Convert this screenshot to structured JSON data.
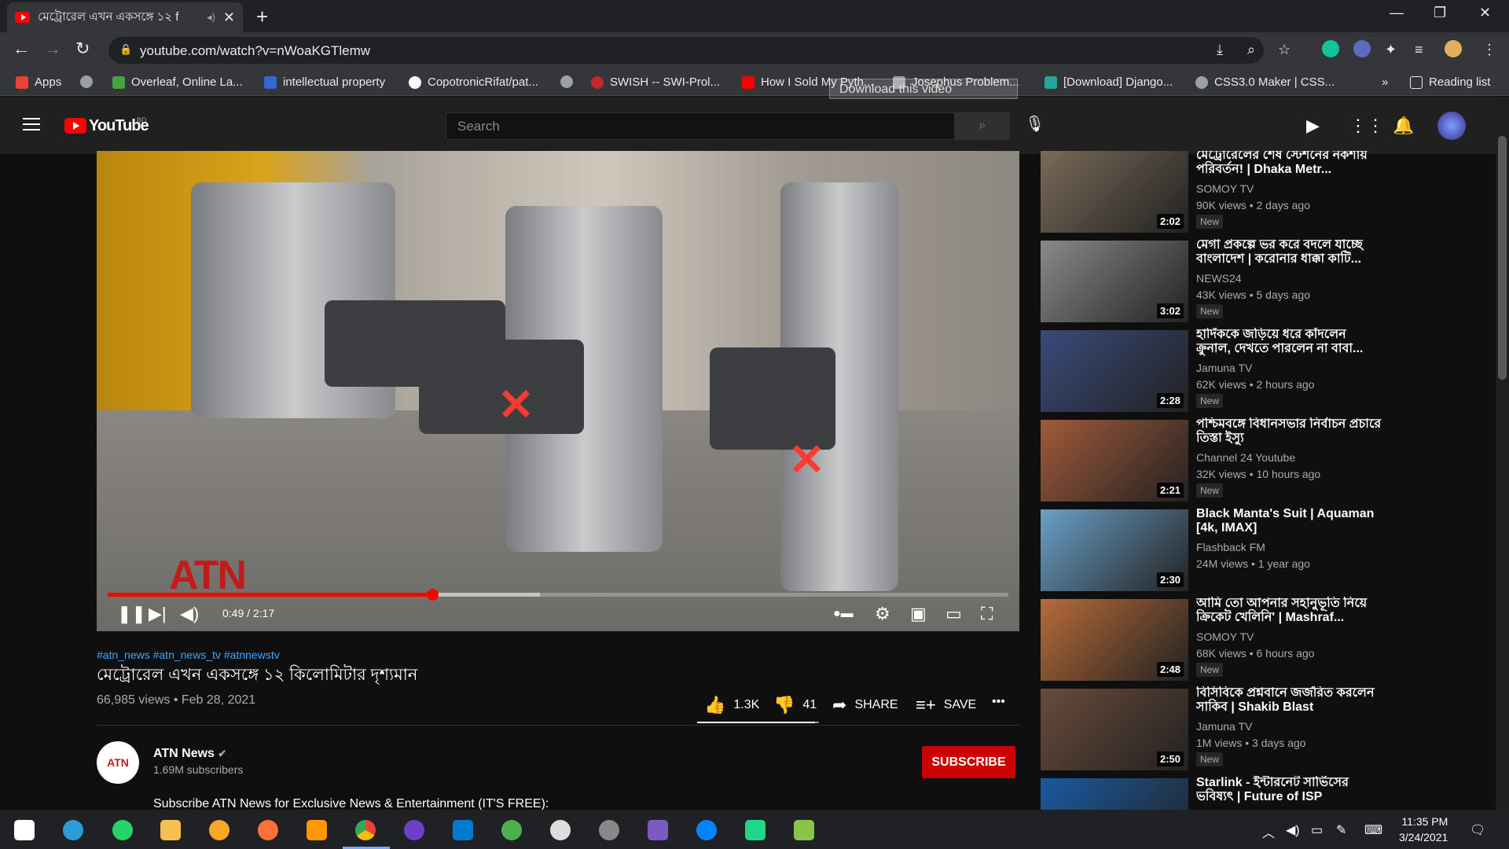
{
  "browser": {
    "tab_title": "মেট্রোরেল এখন একসঙ্গে ১২ f",
    "url": "youtube.com/watch?v=nWoaKGTlemw",
    "new_tab_label": "+",
    "close_label": "✕",
    "win_min": "—",
    "win_max": "❐",
    "win_close": "✕",
    "reading_list": "Reading list",
    "more_bookmarks": "»"
  },
  "bookmarks": [
    {
      "label": "Apps",
      "color": "#ea4335"
    },
    {
      "label": "",
      "color": "#9aa0a6"
    },
    {
      "label": "Overleaf, Online La...",
      "color": "#47a141"
    },
    {
      "label": "intellectual property",
      "color": "#3367d6"
    },
    {
      "label": "CopotronicRifat/pat...",
      "color": "#ffffff"
    },
    {
      "label": "",
      "color": "#9aa0a6"
    },
    {
      "label": "SWISH -- SWI-Prol...",
      "color": "#c62828"
    },
    {
      "label": "How I Sold My Pyth...",
      "color": "#ff0000"
    },
    {
      "label": "Josephus Problem...",
      "color": "#9aa0a6"
    },
    {
      "label": "[Download] Django...",
      "color": "#26a69a"
    },
    {
      "label": "CSS3.0 Maker | CSS...",
      "color": "#9aa0a6"
    }
  ],
  "youtube": {
    "logo_text": "YouTube",
    "country": "BD",
    "search_placeholder": "Search"
  },
  "player": {
    "download_label": "Download this video",
    "watermark": "ATN",
    "time": "0:49 / 2:17",
    "progress_played": 0.36,
    "progress_buffered": 0.48
  },
  "video": {
    "tags": "#atn_news #atn_news_tv #atnnewstv",
    "title": "মেট্রোরেল এখন একসঙ্গে ১২ কিলোমিটার দৃশ্যমান",
    "views": "66,985 views • Feb 28, 2021",
    "likes": "1.3K",
    "dislikes": "41",
    "like_ratio": 0.97,
    "share": "SHARE",
    "save": "SAVE",
    "more": "•••"
  },
  "channel": {
    "name": "ATN News",
    "subs": "1.69M subscribers",
    "avatar_text": "ATN",
    "subscribe": "SUBSCRIBE",
    "description": "Subscribe ATN News for Exclusive News & Entertainment (IT'S FREE):"
  },
  "recommendations": [
    {
      "title": "মেট্রোরেলের শেষ স্টেশনের নকশায় পরিবর্তন! | Dhaka Metr...",
      "channel": "SOMOY TV",
      "meta": "90K views • 2 days ago",
      "duration": "2:02",
      "new": "New",
      "color": "#7a6a58"
    },
    {
      "title": "মেগা প্রকল্পে ভর করে বদলে যাচ্ছে বাংলাদেশ | করোনার ধাক্কা কাটি...",
      "channel": "NEWS24",
      "meta": "43K views • 5 days ago",
      "duration": "3:02",
      "new": "New",
      "color": "#8a8a8a"
    },
    {
      "title": "হার্দিককে জড়িয়ে ধরে কাঁদলেন ক্রুনাল, দেখতে পারলেন না বাবা...",
      "channel": "Jamuna TV",
      "meta": "62K views • 2 hours ago",
      "duration": "2:28",
      "new": "New",
      "color": "#3a4a7a"
    },
    {
      "title": "পশ্চিমবঙ্গে বিধানসভার নির্বাচন প্রচারে তিস্তা ইস্যু",
      "channel": "Channel 24 Youtube",
      "meta": "32K views • 10 hours ago",
      "duration": "2:21",
      "new": "New",
      "color": "#a05a3a"
    },
    {
      "title": "Black Manta's Suit | Aquaman [4k, IMAX]",
      "channel": "Flashback FM",
      "meta": "24M views • 1 year ago",
      "duration": "2:30",
      "new": "",
      "color": "#6aa0c8"
    },
    {
      "title": "আমি তো আপনার সহানুভূতি নিয়ে ক্রিকেট খেলিনি' | Mashraf...",
      "channel": "SOMOY TV",
      "meta": "68K views • 6 hours ago",
      "duration": "2:48",
      "new": "New",
      "color": "#b86a3a"
    },
    {
      "title": "বিসিবিকে প্রশ্নবানে জর্জরিত করলেন সাকিব | Shakib Blast",
      "channel": "Jamuna TV",
      "meta": "1M views • 3 days ago",
      "duration": "2:50",
      "new": "New",
      "color": "#6a4a3a"
    },
    {
      "title": "Starlink - ইন্টারনেট সার্ভিসের ভবিষ্যৎ | Future of ISP",
      "channel": "",
      "meta": "",
      "duration": "",
      "new": "",
      "color": "#1a5aa0"
    }
  ],
  "taskbar": {
    "time": "11:35 PM",
    "date": "3/24/2021"
  }
}
